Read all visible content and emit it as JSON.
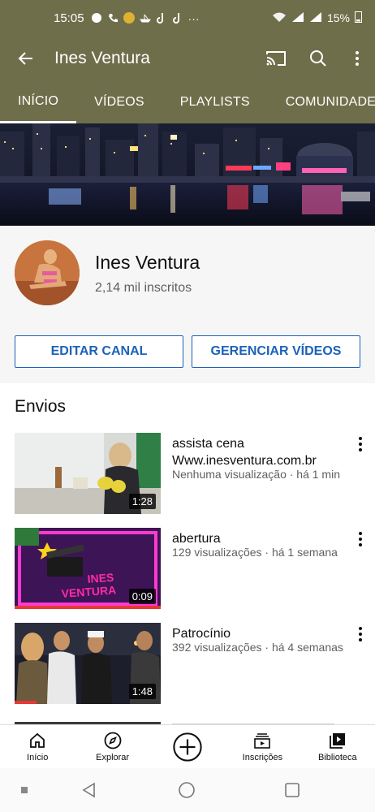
{
  "status": {
    "time": "15:05",
    "battery": "15%"
  },
  "app_bar": {
    "title": "Ines Ventura",
    "icons": [
      "back-arrow-icon",
      "cast-icon",
      "search-icon",
      "more-vert-icon"
    ]
  },
  "tabs": [
    {
      "label": "INÍCIO",
      "active": true
    },
    {
      "label": "VÍDEOS",
      "active": false
    },
    {
      "label": "PLAYLISTS",
      "active": false
    },
    {
      "label": "COMUNIDADE",
      "active": false
    }
  ],
  "channel": {
    "name": "Ines Ventura",
    "subscribers": "2,14 mil inscritos",
    "edit_label": "EDITAR CANAL",
    "manage_label": "GERENCIAR VÍDEOS"
  },
  "uploads": {
    "title": "Envios",
    "videos": [
      {
        "title": "assista cena Www.inesventura.com.br",
        "meta": "Nenhuma visualização · há 1 min",
        "duration": "1:28",
        "watched": 0
      },
      {
        "title": "abertura",
        "meta": "129 visualizações · há 1 semana",
        "duration": "0:09",
        "watched": 1.0
      },
      {
        "title": "Patrocínio",
        "meta": "392 visualizações · há 4 semanas",
        "duration": "1:48",
        "watched": 0.15
      }
    ]
  },
  "bottom_nav": [
    {
      "label": "Início",
      "icon": "home-icon"
    },
    {
      "label": "Explorar",
      "icon": "compass-icon"
    },
    {
      "label": "",
      "icon": "create-plus-icon"
    },
    {
      "label": "Inscrições",
      "icon": "subscriptions-icon"
    },
    {
      "label": "Biblioteca",
      "icon": "library-icon"
    }
  ],
  "colors": {
    "header_bg": "#6e6e4a",
    "accent_blue": "#1c62b9",
    "progress_red": "#e53935"
  }
}
